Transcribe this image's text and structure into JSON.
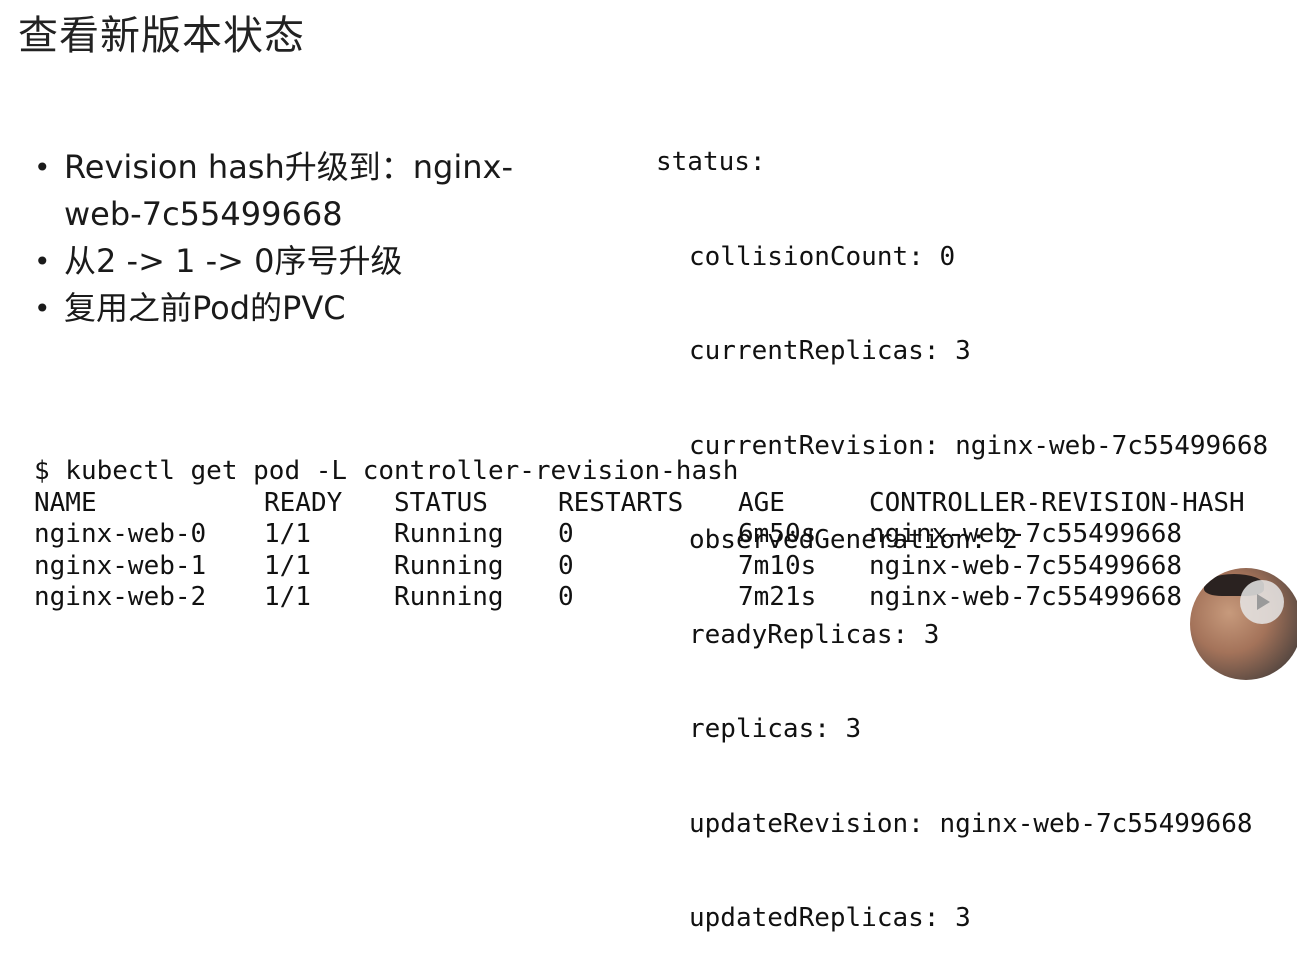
{
  "title": "查看新版本状态",
  "bullets": [
    "Revision hash升级到：nginx-web-7c55499668",
    "从2 -> 1 -> 0序号升级",
    "复用之前Pod的PVC"
  ],
  "bullet_symbol": "•",
  "status_yaml": {
    "header": "status:",
    "lines": [
      "collisionCount: 0",
      "currentReplicas: 3",
      "currentRevision: nginx-web-7c55499668",
      "observedGeneration: 2",
      "readyReplicas: 3",
      "replicas: 3",
      "updateRevision: nginx-web-7c55499668",
      "updatedReplicas: 3"
    ]
  },
  "terminal": {
    "command": "$ kubectl get pod -L controller-revision-hash",
    "columns": [
      "NAME",
      "READY",
      "STATUS",
      "RESTARTS",
      "AGE",
      "CONTROLLER-REVISION-HASH"
    ],
    "rows": [
      [
        "nginx-web-0",
        "1/1",
        "Running",
        "0",
        "6m50s",
        "nginx-web-7c55499668"
      ],
      [
        "nginx-web-1",
        "1/1",
        "Running",
        "0",
        "7m10s",
        "nginx-web-7c55499668"
      ],
      [
        "nginx-web-2",
        "1/1",
        "Running",
        "0",
        "7m21s",
        "nginx-web-7c55499668"
      ]
    ]
  },
  "overlay": {
    "play_icon": "play-icon",
    "avatar_icon": "presenter-avatar"
  }
}
